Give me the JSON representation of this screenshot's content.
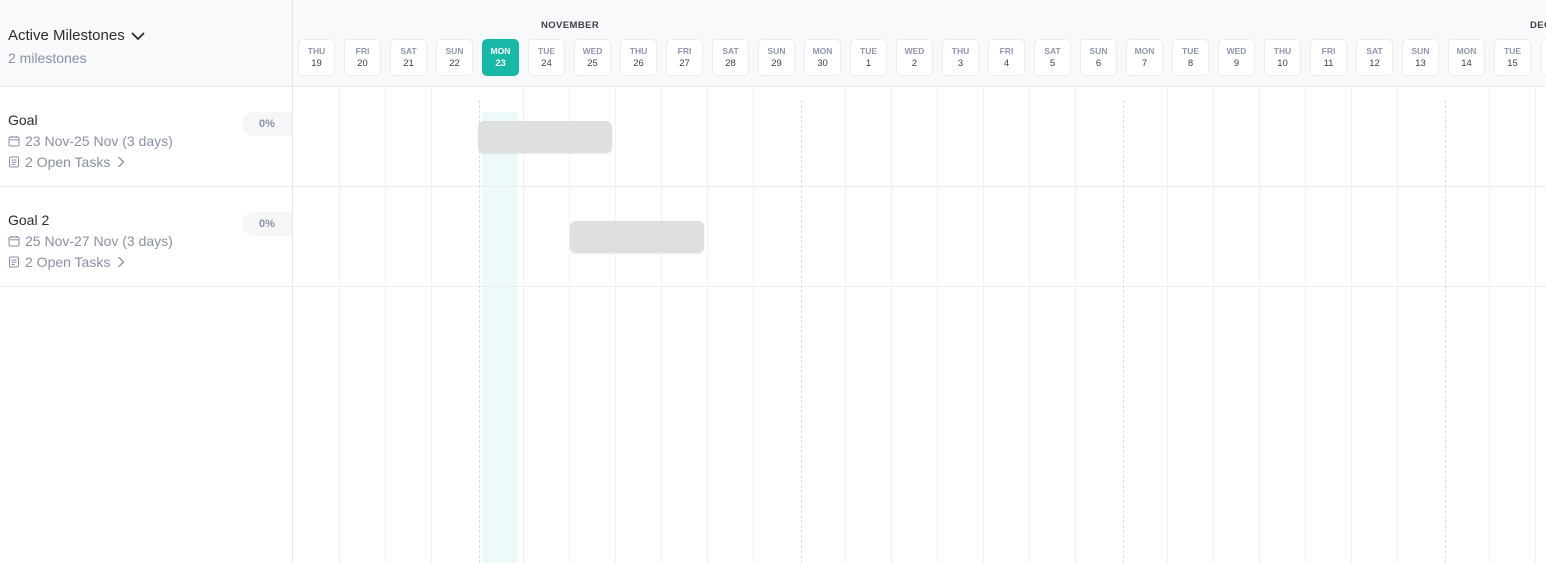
{
  "panel": {
    "title": "Active Milestones",
    "count": "2 milestones"
  },
  "milestones": [
    {
      "name": "Goal",
      "dates": "23 Nov-25 Nov (3 days)",
      "tasks": "2 Open Tasks",
      "progress": "0%",
      "start_day_index": 4,
      "end_day_index": 6
    },
    {
      "name": "Goal 2",
      "dates": "25 Nov-27 Nov (3 days)",
      "tasks": "2 Open Tasks",
      "progress": "0%",
      "start_day_index": 6,
      "end_day_index": 8
    }
  ],
  "timeline": {
    "months": [
      "NOVEMBER",
      "DEC"
    ],
    "today_index": 4,
    "days": [
      {
        "dow": "THU",
        "num": "19"
      },
      {
        "dow": "FRI",
        "num": "20"
      },
      {
        "dow": "SAT",
        "num": "21"
      },
      {
        "dow": "SUN",
        "num": "22"
      },
      {
        "dow": "MON",
        "num": "23"
      },
      {
        "dow": "TUE",
        "num": "24"
      },
      {
        "dow": "WED",
        "num": "25"
      },
      {
        "dow": "THU",
        "num": "26"
      },
      {
        "dow": "FRI",
        "num": "27"
      },
      {
        "dow": "SAT",
        "num": "28"
      },
      {
        "dow": "SUN",
        "num": "29"
      },
      {
        "dow": "MON",
        "num": "30"
      },
      {
        "dow": "TUE",
        "num": "1"
      },
      {
        "dow": "WED",
        "num": "2"
      },
      {
        "dow": "THU",
        "num": "3"
      },
      {
        "dow": "FRI",
        "num": "4"
      },
      {
        "dow": "SAT",
        "num": "5"
      },
      {
        "dow": "SUN",
        "num": "6"
      },
      {
        "dow": "MON",
        "num": "7"
      },
      {
        "dow": "TUE",
        "num": "8"
      },
      {
        "dow": "WED",
        "num": "9"
      },
      {
        "dow": "THU",
        "num": "10"
      },
      {
        "dow": "FRI",
        "num": "11"
      },
      {
        "dow": "SAT",
        "num": "12"
      },
      {
        "dow": "SUN",
        "num": "13"
      },
      {
        "dow": "MON",
        "num": "14"
      },
      {
        "dow": "TUE",
        "num": "15"
      }
    ]
  },
  "colors": {
    "accent": "#17b8a6",
    "bar": "#dedfe1",
    "muted_text": "#8a90a6"
  }
}
